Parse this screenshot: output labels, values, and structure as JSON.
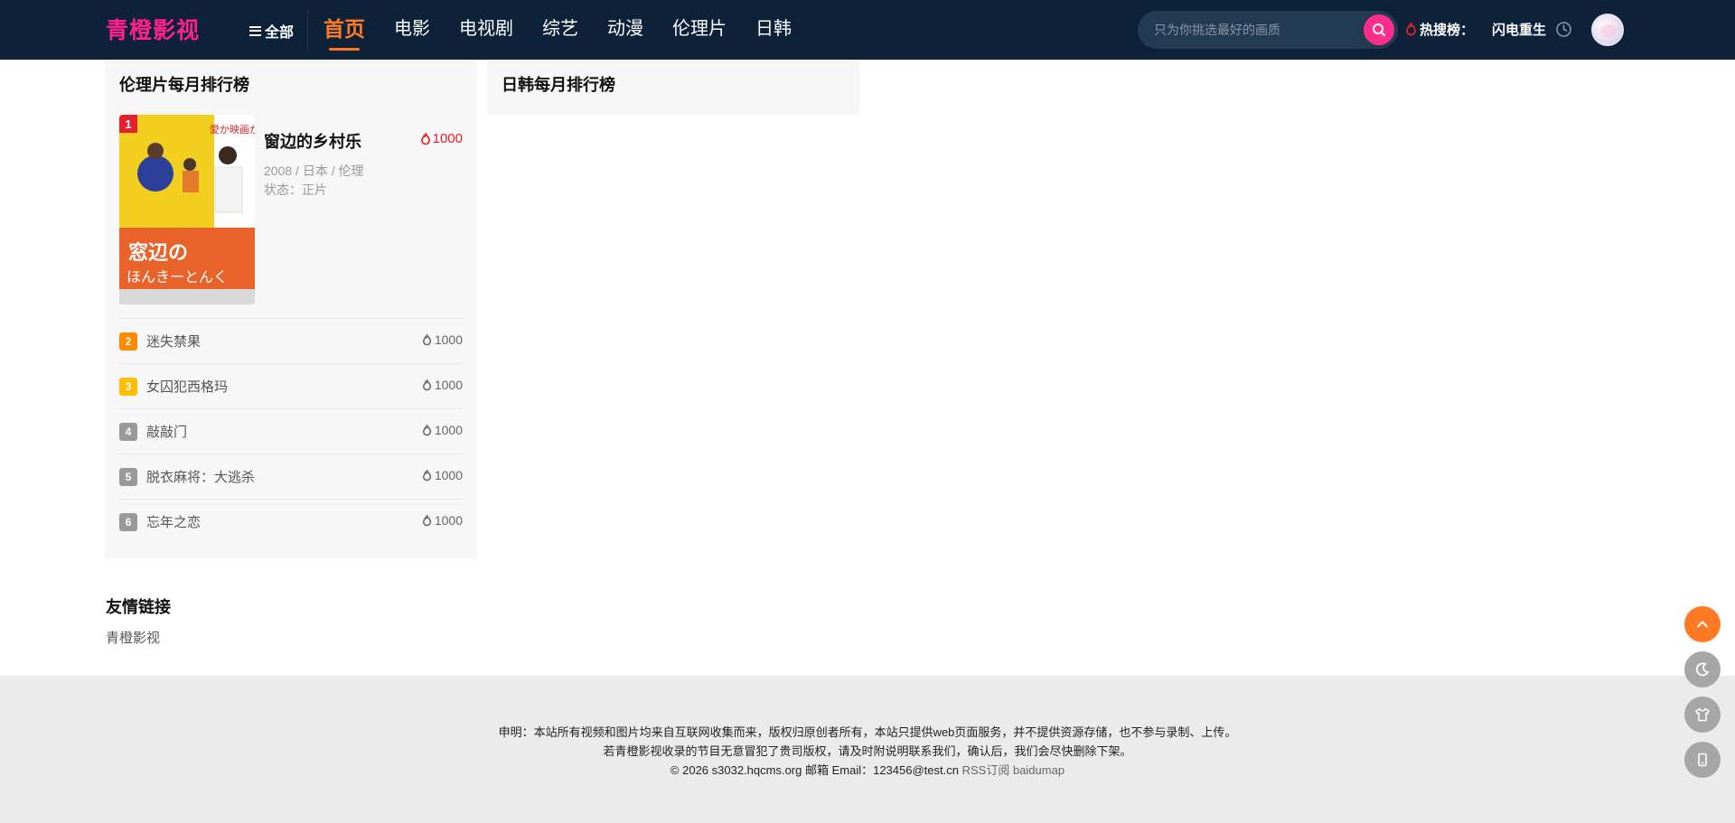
{
  "header": {
    "logo": "青橙影视",
    "all_menu": "全部",
    "nav": [
      "首页",
      "电影",
      "电视剧",
      "综艺",
      "动漫",
      "伦理片",
      "日韩"
    ],
    "active_nav": "首页",
    "search": {
      "placeholder": "只为你挑选最好的画质"
    },
    "hot": {
      "label": "热搜榜：",
      "item": "闪电重生"
    }
  },
  "ranking_1": {
    "title": "伦理片每月排行榜",
    "top": {
      "rank": "1",
      "title": "窗边的乡村乐",
      "heat": "1000",
      "meta": "2008 / 日本 / 伦理",
      "status": "状态：正片",
      "poster_text": "愛か映画か。"
    },
    "items": [
      {
        "rank": "2",
        "name": "迷失禁果",
        "heat": "1000",
        "color": "#ff8a00"
      },
      {
        "rank": "3",
        "name": "女囚犯西格玛",
        "heat": "1000",
        "color": "#ffbf00"
      },
      {
        "rank": "4",
        "name": "敲敲门",
        "heat": "1000",
        "color": "#999999"
      },
      {
        "rank": "5",
        "name": "脱衣麻将：大逃杀",
        "heat": "1000",
        "color": "#999999"
      },
      {
        "rank": "6",
        "name": "忘年之恋",
        "heat": "1000",
        "color": "#999999"
      }
    ]
  },
  "ranking_2": {
    "title": "日韩每月排行榜"
  },
  "links": {
    "title": "友情链接",
    "items": [
      "青橙影视"
    ]
  },
  "footer": {
    "line1": "申明：本站所有视频和图片均来自互联网收集而来，版权归原创者所有，本站只提供web页面服务，并不提供资源存储，也不参与录制、上传。",
    "line2": "若青橙影视收录的节目无意冒犯了贵司版权，请及时附说明联系我们，确认后，我们会尽快删除下架。",
    "copyright": "© 2026 s3032.hqcms.org  邮箱 Email：123456@test.cn",
    "rss": "RSS订阅",
    "sitemap": "baidumap"
  },
  "colors": {
    "header_bg": "#0d2139",
    "accent": "#ff7a22",
    "logo": "#ff1f8f",
    "rank1": "#e5202b"
  }
}
